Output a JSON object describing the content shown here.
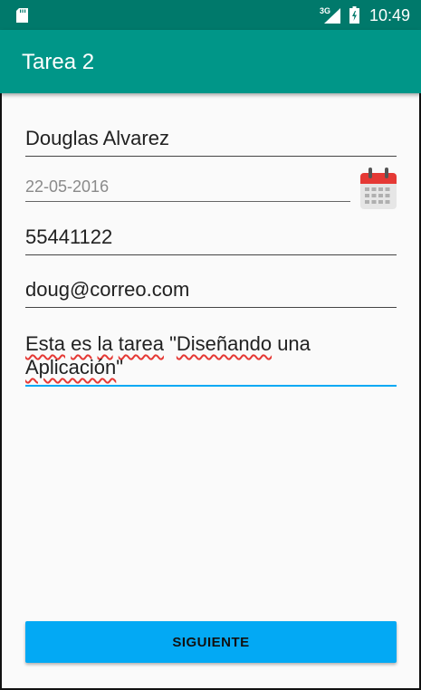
{
  "status_bar": {
    "network": "3G",
    "time": "10:49",
    "icons": [
      "sd-card-icon",
      "signal-icon",
      "battery-charging-icon"
    ]
  },
  "app_bar": {
    "title": "Tarea 2"
  },
  "form": {
    "name": "Douglas Alvarez",
    "date": "22-05-2016",
    "date_icon": "calendar-icon",
    "phone": "55441122",
    "email": "doug@correo.com",
    "description_words": [
      "Esta",
      "es",
      "la",
      "tarea",
      "\"Diseñando",
      "una",
      "Aplicación\""
    ]
  },
  "button": {
    "label": "SIGUIENTE"
  },
  "colors": {
    "status_bar": "#00796b",
    "app_bar": "#009688",
    "accent": "#03a9f4",
    "spellcheck": "#e53935",
    "background": "#fafafa"
  }
}
